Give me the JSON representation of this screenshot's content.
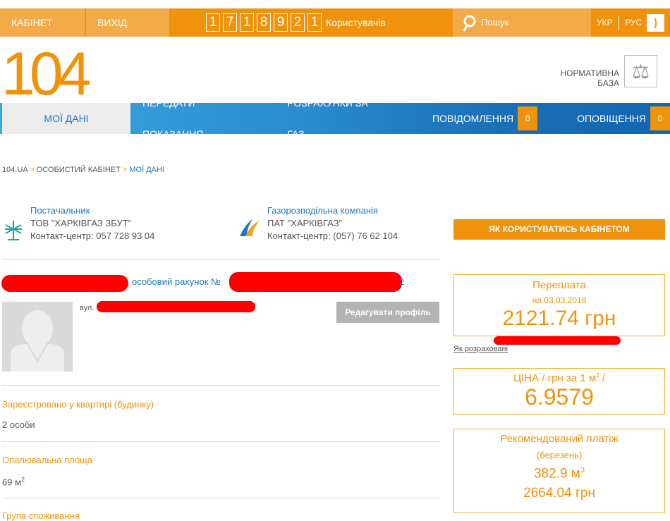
{
  "topbar": {
    "cabinet": "КАБІНЕТ",
    "exit": "ВИХІД",
    "counter_digits": [
      "1",
      "7",
      "1",
      "8",
      "9",
      "2",
      "1"
    ],
    "counter_label": "Користувачів",
    "search": "Пошук",
    "lang_uk": "УКР",
    "lang_ru": "РУС"
  },
  "header": {
    "logo": "104",
    "norm_base_line1": "НОРМАТИВНА",
    "norm_base_line2": "БАЗА"
  },
  "nav": {
    "items": [
      {
        "label": "МОЇ ДАНІ"
      },
      {
        "label": "ПЕРЕДАТИ ПОКАЗАННЯ"
      },
      {
        "label": "РОЗРАХУНКИ ЗА ГАЗ"
      },
      {
        "label": "ПОВІДОМЛЕННЯ",
        "badge": "0"
      },
      {
        "label": "ОПОВІЩЕННЯ",
        "badge": "0"
      }
    ]
  },
  "breadcrumb": {
    "items": [
      "104.UA",
      "ОСОБИСТИЙ КАБІНЕТ",
      "МОЇ ДАНІ"
    ],
    "sep": ">"
  },
  "supplier": {
    "title": "Постачальник",
    "name": "ТОВ \"ХАРКІВГАЗ ЗБУТ\"",
    "contact": "Контакт-центр: 057 728 93 04"
  },
  "distributor": {
    "title": "Газорозподільна компанія",
    "name": "ПАТ \"ХАРКІВГАЗ\"",
    "contact": "Контакт-центр: (057) 76 62 104"
  },
  "account": {
    "label": "особовий рахунок №",
    "suffix": "2",
    "street_prefix": "вул.",
    "edit_profile": "Редагувати профіль"
  },
  "fields": [
    {
      "label": "Зареєстровано у квартирі (будинку)",
      "value": "2 особи"
    },
    {
      "label": "Опалювальна площа",
      "value": "69 м",
      "sup": "2"
    },
    {
      "label": "Група споживання"
    }
  ],
  "sidebar": {
    "how_to": "ЯК КОРИСТУВАТИСЬ КАБІНЕТОМ",
    "overpay": {
      "title": "Переплата",
      "date": "на 03.03.2018",
      "amount": "2121.74 грн"
    },
    "how_calc": "Як розраховані",
    "price": {
      "title": "ЦІНА / грн за 1 м",
      "sup": "3",
      "tail": " /",
      "value": "6.9579"
    },
    "recommended": {
      "title": "Рекомендований платіж",
      "month": "(березень)",
      "volume": "382.9 м",
      "volume_sup": "3",
      "amount": "2664.04 грн"
    }
  },
  "colors": {
    "orange": "#f0930c",
    "blue": "#1a79c0"
  }
}
